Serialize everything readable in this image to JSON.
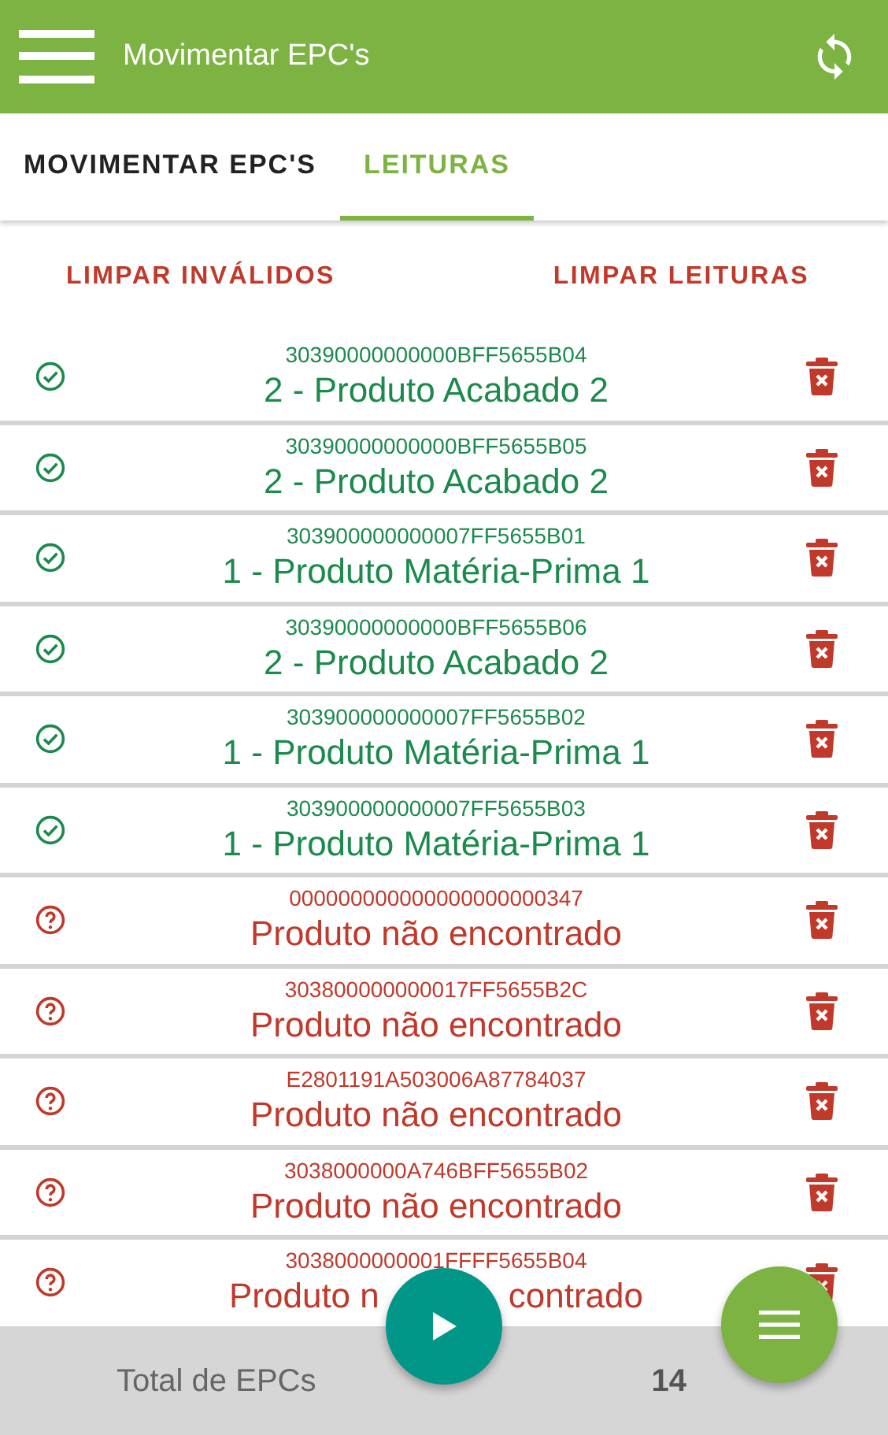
{
  "app_bar": {
    "title": "Movimentar EPC's"
  },
  "tabs": [
    {
      "label": "MOVIMENTAR EPC'S",
      "selected": false
    },
    {
      "label": "LEITURAS",
      "selected": true
    }
  ],
  "actions": [
    "LIMPAR INVÁLIDOS",
    "LIMPAR LEITURAS"
  ],
  "readings": [
    {
      "kind": "valid",
      "epc": "30390000000000BFF5655B04",
      "name": "2 - Produto Acabado 2"
    },
    {
      "kind": "valid",
      "epc": "30390000000000BFF5655B05",
      "name": "2 - Produto Acabado 2"
    },
    {
      "kind": "valid",
      "epc": "303900000000007FF5655B01",
      "name": "1 - Produto Matéria-Prima 1"
    },
    {
      "kind": "valid",
      "epc": "30390000000000BFF5655B06",
      "name": "2 - Produto Acabado 2"
    },
    {
      "kind": "valid",
      "epc": "303900000000007FF5655B02",
      "name": "1 - Produto Matéria-Prima 1"
    },
    {
      "kind": "valid",
      "epc": "303900000000007FF5655B03",
      "name": "1 - Produto Matéria-Prima 1"
    },
    {
      "kind": "invalid",
      "epc": "000000000000000000000347",
      "name": "Produto não encontrado"
    },
    {
      "kind": "invalid",
      "epc": "303800000000017FF5655B2C",
      "name": "Produto não encontrado"
    },
    {
      "kind": "invalid",
      "epc": "E2801191A503006A87784037",
      "name": "Produto não encontrado"
    },
    {
      "kind": "invalid",
      "epc": "3038000000A746BFF5655B02",
      "name": "Produto não encontrado"
    },
    {
      "kind": "invalid",
      "epc": "3038000000001FFFF5655B04",
      "name": "Produto n",
      "name_tail": "contrado"
    }
  ],
  "footer": {
    "label": "Total de EPCs",
    "count": "14"
  }
}
